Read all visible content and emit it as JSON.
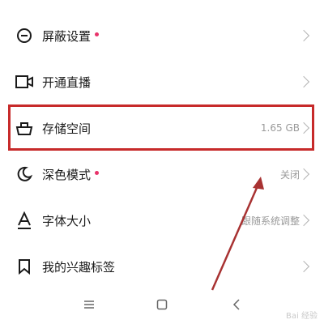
{
  "settings": {
    "items": [
      {
        "label": "屏蔽设置",
        "icon": "minus-circle-icon",
        "dot": true,
        "value": ""
      },
      {
        "label": "开通直播",
        "icon": "video-camera-icon",
        "dot": false,
        "value": ""
      },
      {
        "label": "存储空间",
        "icon": "basket-icon",
        "dot": false,
        "value": "1.65 GB"
      },
      {
        "label": "深色模式",
        "icon": "moon-icon",
        "dot": true,
        "value": "关闭"
      },
      {
        "label": "字体大小",
        "icon": "font-size-icon",
        "dot": false,
        "value": "跟随系统调整"
      },
      {
        "label": "我的兴趣标签",
        "icon": "bookmark-icon",
        "dot": false,
        "value": ""
      }
    ]
  },
  "navbar": {
    "icons": [
      "menu-icon",
      "home-square-icon",
      "back-icon"
    ]
  },
  "colors": {
    "accent_dot": "#e8336a",
    "highlight_border": "#c72a2a",
    "arrow": "#a83232"
  },
  "watermark": "Bai 经验"
}
